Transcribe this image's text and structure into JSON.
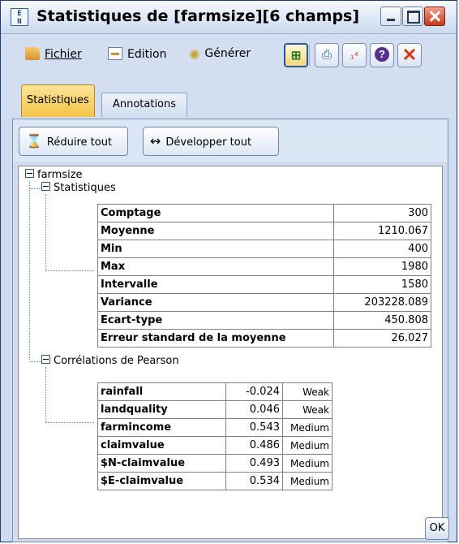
{
  "window": {
    "title": "Statistiques de [farmsize][6 champs]",
    "app_icon_text": "EX\nN"
  },
  "menubar": {
    "items": [
      {
        "label": "Fichier",
        "icon": "folder-icon"
      },
      {
        "label": "Edition",
        "icon": "edit-icon"
      },
      {
        "label": "Générer",
        "icon": "generate-icon"
      }
    ],
    "tools": [
      "export-icon",
      "print-icon",
      "graph-icon",
      "help-icon",
      "close-icon"
    ]
  },
  "tabs": [
    {
      "label": "Statistiques",
      "active": true
    },
    {
      "label": "Annotations",
      "active": false
    }
  ],
  "actions": {
    "collapse_label": "Réduire tout",
    "expand_label": "Développer tout"
  },
  "tree": {
    "root": "farmsize",
    "statistics_node": "Statistiques",
    "correlations_node": "Corrélations de Pearson"
  },
  "statistics": [
    {
      "label": "Comptage",
      "value": "300"
    },
    {
      "label": "Moyenne",
      "value": "1210.067"
    },
    {
      "label": "Min",
      "value": "400"
    },
    {
      "label": "Max",
      "value": "1980"
    },
    {
      "label": "Intervalle",
      "value": "1580"
    },
    {
      "label": "Variance",
      "value": "203228.089"
    },
    {
      "label": "Ecart-type",
      "value": "450.808"
    },
    {
      "label": "Erreur standard de la moyenne",
      "value": "26.027"
    }
  ],
  "correlations": [
    {
      "field": "rainfall",
      "value": "-0.024",
      "strength": "Weak"
    },
    {
      "field": "landquality",
      "value": "0.046",
      "strength": "Weak"
    },
    {
      "field": "farmincome",
      "value": "0.543",
      "strength": "Medium"
    },
    {
      "field": "claimvalue",
      "value": "0.486",
      "strength": "Medium"
    },
    {
      "field": "$N-claimvalue",
      "value": "0.493",
      "strength": "Medium"
    },
    {
      "field": "$E-claimvalue",
      "value": "0.534",
      "strength": "Medium"
    }
  ],
  "footer": {
    "ok_label": "OK"
  }
}
